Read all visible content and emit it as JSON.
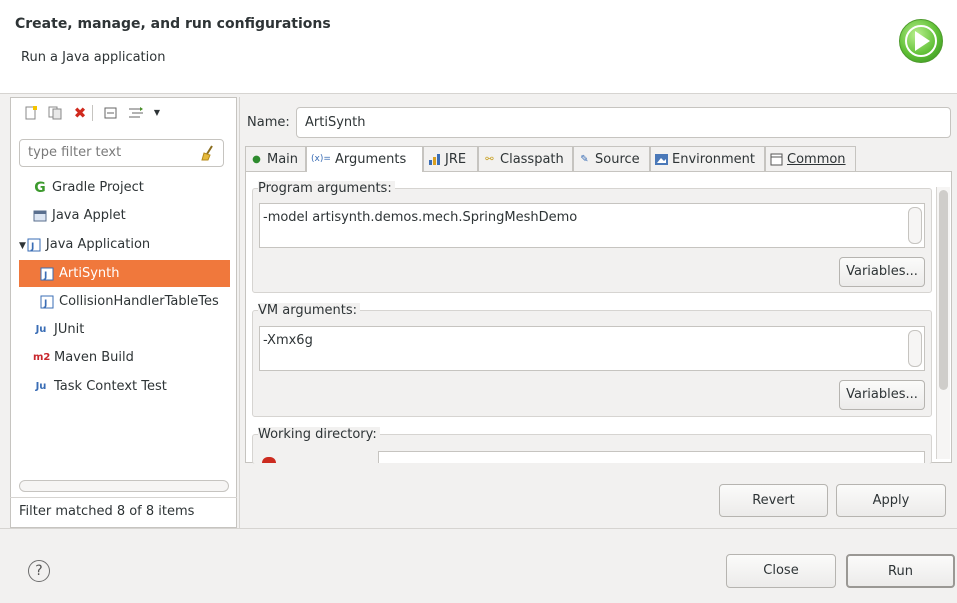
{
  "header": {
    "title": "Create, manage, and run configurations",
    "subtitle": "Run a Java application",
    "run_icon": "run-icon"
  },
  "left": {
    "toolbar_icons": [
      "new-configuration-icon",
      "duplicate-icon",
      "delete-icon",
      "collapse-all-icon",
      "filter-icon",
      "dropdown-arrow-icon"
    ],
    "filter_placeholder": "type filter text",
    "tree": [
      {
        "label": "Gradle Project",
        "icon": "gradle-icon"
      },
      {
        "label": "Java Applet",
        "icon": "java-applet-icon"
      },
      {
        "label": "Java Application",
        "icon": "java-application-icon",
        "expanded": true
      },
      {
        "label": "ArtiSynth",
        "icon": "java-class-icon",
        "selected": true
      },
      {
        "label": "CollisionHandlerTableTes",
        "icon": "java-class-icon"
      },
      {
        "label": "JUnit",
        "icon": "junit-icon"
      },
      {
        "label": "Maven Build",
        "icon": "maven-icon"
      },
      {
        "label": "Task Context Test",
        "icon": "task-context-icon"
      }
    ],
    "status": "Filter matched 8 of 8 items"
  },
  "right": {
    "name_label": "Name:",
    "name_value": "ArtiSynth",
    "tabs": [
      {
        "label": "Main",
        "icon": "main-tab-icon"
      },
      {
        "label": "Arguments",
        "icon": "arguments-tab-icon",
        "active": true
      },
      {
        "label": "JRE",
        "icon": "jre-tab-icon"
      },
      {
        "label": "Classpath",
        "icon": "classpath-tab-icon"
      },
      {
        "label": "Source",
        "icon": "source-tab-icon"
      },
      {
        "label": "Environment",
        "icon": "environment-tab-icon"
      },
      {
        "label": "Common",
        "icon": "common-tab-icon"
      }
    ],
    "program_args": {
      "label": "Program arguments:",
      "value": "-model artisynth.demos.mech.SpringMeshDemo",
      "variables_button": "Variables..."
    },
    "vm_args": {
      "label": "VM arguments:",
      "value": "-Xmx6g",
      "variables_button": "Variables..."
    },
    "working_directory": {
      "label": "Working directory:"
    },
    "revert_button": "Revert",
    "apply_button": "Apply"
  },
  "footer": {
    "close_button": "Close",
    "run_button": "Run"
  },
  "colors": {
    "selection": "#f0783c",
    "background": "#f2f1f0"
  }
}
